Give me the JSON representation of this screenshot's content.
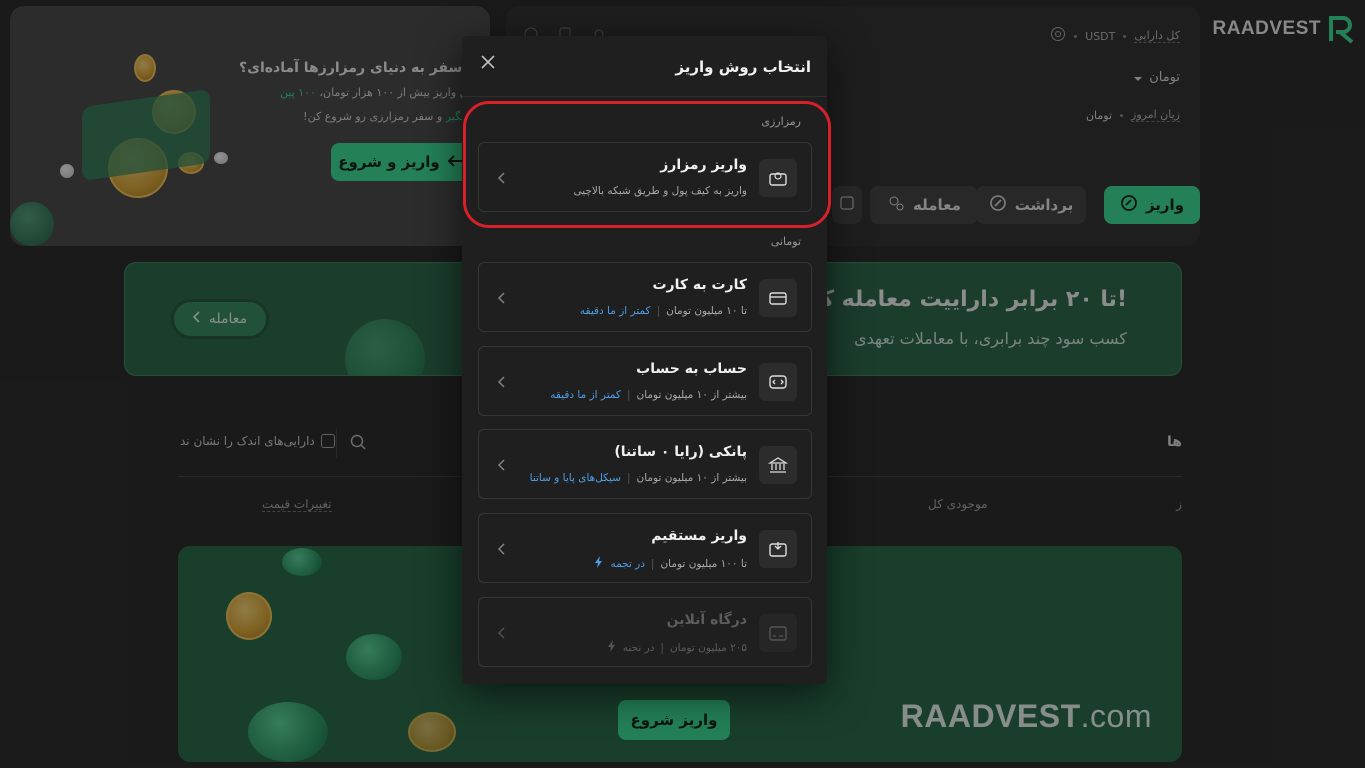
{
  "brand": {
    "logo_text": "RAADVEST"
  },
  "promo": {
    "headline": "ی سفر به دنیای رمزارزها آماده‌ای؟",
    "line1": "ولین واریز بیش از ۱۰۰ هزار تومان،",
    "line1_highlight": "۱۰۰ پین",
    "line2_prefix": "و سفر رمزارزی رو شروع کن!",
    "line2_highlight": "تیه بگیر",
    "button": "واریز و شروع"
  },
  "wallet": {
    "total_label": "کل دارایی",
    "currency": "USDT",
    "toman_select": "تومان",
    "today_pl_label": "زیان امروز",
    "today_pl_unit": "تومان",
    "actions": {
      "deposit": "واریز",
      "withdraw": "برداشت",
      "trade": "معامله"
    }
  },
  "banner": {
    "title": "تا ۲۰ برابر داراییت معامله کن!",
    "subtitle": "کسب سود چند برابری، با معاملات تعهدی",
    "button": "معامله"
  },
  "assets": {
    "section_title": "ها",
    "hide_small_label": "دارایی‌های اندک را نشان ند",
    "col_name": "ز",
    "col_total": "موجودی کل",
    "col_change": "تغییرات قیمت"
  },
  "bottom_banner": {
    "site_name_main": "RAADVEST",
    "site_name_suffix": ".com",
    "button": "واریز شروع"
  },
  "modal": {
    "title": "انتخاب روش واریز",
    "group_crypto": "رمزارزی",
    "group_toman": "تومانی",
    "options": [
      {
        "title": "واریز رمزارز",
        "sub": "واریز به کیف پول و طریق شبکه بالاچیی",
        "tag": ""
      },
      {
        "title": "کارت به کارت",
        "sub": "تا ۱۰ میلیون تومان",
        "tag": "کمتر از ما دقیقه"
      },
      {
        "title": "حساب به حساب",
        "sub": "بیشتر از ۱۰ میلیون تومان",
        "tag": "کمتر از ما دقیقه"
      },
      {
        "title": "پانکی (رایا ۰ ساتنا)",
        "sub": "بیشتر از ۱۰ میلیون تومان",
        "tag": "سیکل‌های پایا و ساتنا"
      },
      {
        "title": "واریز مستقیم",
        "sub": "تا ۱۰۰ میلیون تومان",
        "tag": "در تجمه"
      },
      {
        "title": "درگاه آنلاین",
        "sub": "۲۰۵ میلیون تومان",
        "tag": "در نحنه"
      }
    ]
  },
  "colors": {
    "accent_green": "#3ddc97",
    "link_blue": "#4d9fe8",
    "highlight_red": "#d6202a"
  }
}
